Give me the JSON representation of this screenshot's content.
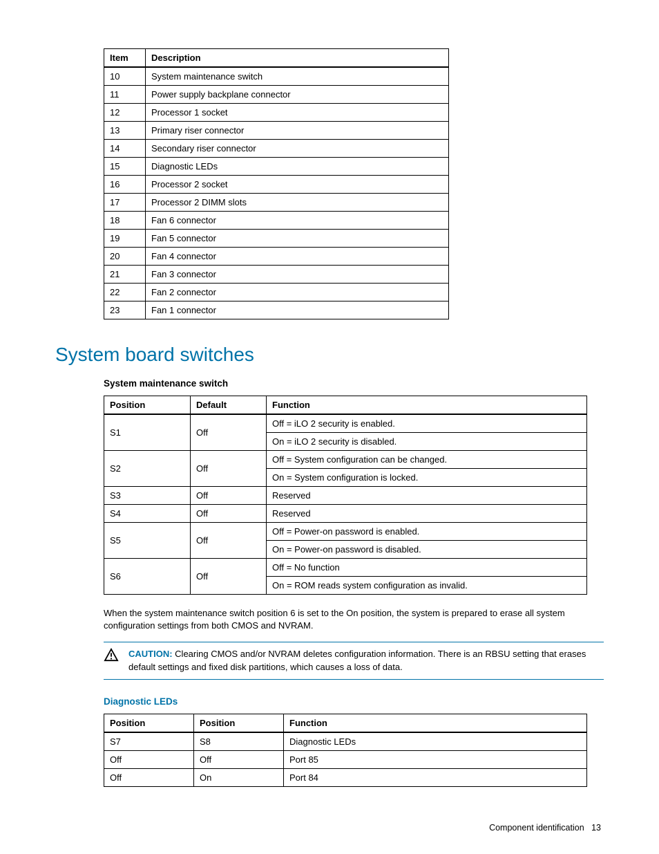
{
  "table1": {
    "headers": [
      "Item",
      "Description"
    ],
    "rows": [
      [
        "10",
        "System maintenance switch"
      ],
      [
        "11",
        "Power supply backplane connector"
      ],
      [
        "12",
        "Processor 1 socket"
      ],
      [
        "13",
        "Primary riser connector"
      ],
      [
        "14",
        "Secondary riser connector"
      ],
      [
        "15",
        "Diagnostic LEDs"
      ],
      [
        "16",
        "Processor 2 socket"
      ],
      [
        "17",
        "Processor 2 DIMM slots"
      ],
      [
        "18",
        "Fan 6 connector"
      ],
      [
        "19",
        "Fan 5 connector"
      ],
      [
        "20",
        "Fan 4 connector"
      ],
      [
        "21",
        "Fan 3 connector"
      ],
      [
        "22",
        "Fan 2 connector"
      ],
      [
        "23",
        "Fan 1 connector"
      ]
    ]
  },
  "section_title": "System board switches",
  "subheading_switch": "System maintenance switch",
  "table2": {
    "headers": {
      "position": "Position",
      "default": "Default",
      "function": "Function"
    },
    "rows": [
      {
        "position": "S1",
        "default": "Off",
        "functions": [
          "Off = iLO 2 security is enabled.",
          "On = iLO 2 security is disabled."
        ]
      },
      {
        "position": "S2",
        "default": "Off",
        "functions": [
          "Off = System configuration can be changed.",
          "On = System configuration is locked."
        ]
      },
      {
        "position": "S3",
        "default": "Off",
        "functions": [
          "Reserved"
        ]
      },
      {
        "position": "S4",
        "default": "Off",
        "functions": [
          "Reserved"
        ]
      },
      {
        "position": "S5",
        "default": "Off",
        "functions": [
          "Off = Power-on password is enabled.",
          "On = Power-on password is disabled."
        ]
      },
      {
        "position": "S6",
        "default": "Off",
        "functions": [
          "Off = No function",
          "On = ROM reads system configuration as invalid."
        ]
      }
    ]
  },
  "paragraph": "When the system maintenance switch position 6 is set to the On position, the system is prepared to erase all system configuration settings from both CMOS and NVRAM.",
  "caution": {
    "label": "CAUTION:",
    "text": "Clearing CMOS and/or NVRAM deletes configuration information. There is an RBSU setting that erases default settings and fixed disk partitions, which causes a loss of data."
  },
  "subheading_leds": "Diagnostic LEDs",
  "table3": {
    "headers": [
      "Position",
      "Position",
      "Function"
    ],
    "rows": [
      [
        "S7",
        "S8",
        "Diagnostic LEDs"
      ],
      [
        "Off",
        "Off",
        "Port 85"
      ],
      [
        "Off",
        "On",
        "Port 84"
      ]
    ]
  },
  "footer": {
    "section": "Component identification",
    "page": "13"
  }
}
